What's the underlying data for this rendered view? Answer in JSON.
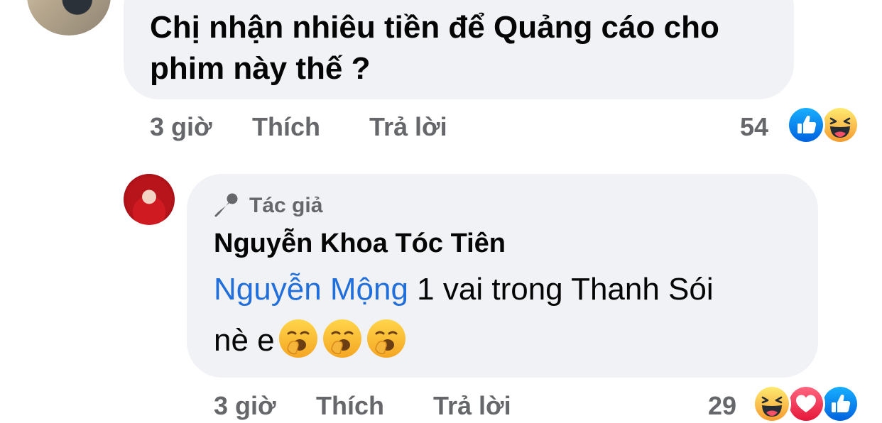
{
  "comment1": {
    "text": "Chị nhận nhiêu tiền để Quảng cáo cho phim này thế ?",
    "time": "3 giờ",
    "like_label": "Thích",
    "reply_label": "Trả lời",
    "reaction_count": "54",
    "reactions": [
      "like-icon",
      "haha-icon"
    ]
  },
  "comment2": {
    "badge_icon": "microphone-icon",
    "badge_label": "Tác giả",
    "author": "Nguyễn Khoa Tóc Tiên",
    "mention": "Nguyễn Mộng",
    "text_after_mention": " 1 vai trong Thanh Sói",
    "text_line2": "nè e",
    "emojis": [
      "yawning-face-icon",
      "yawning-face-icon",
      "yawning-face-icon"
    ],
    "time": "3 giờ",
    "like_label": "Thích",
    "reply_label": "Trả lời",
    "reaction_count": "29",
    "reactions": [
      "haha-icon",
      "love-icon",
      "like-icon"
    ]
  },
  "colors": {
    "bubble": "#f0f2f5",
    "meta_text": "#65676b",
    "mention": "#216fdb",
    "like_blue": "#1877f2",
    "love_red": "#f33e58",
    "haha_yellow": "#f7b125"
  }
}
